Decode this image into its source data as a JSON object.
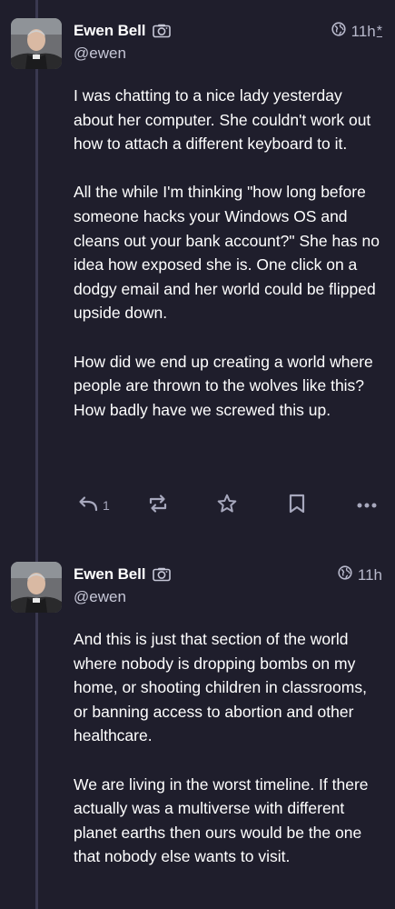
{
  "colors": {
    "background": "#1f1e2c",
    "text": "#ffffff",
    "muted": "#b8b9cc",
    "icon": "#a7a8bd",
    "thread_line": "#3a3950"
  },
  "posts": [
    {
      "author": {
        "display_name": "Ewen Bell",
        "handle": "@ewen",
        "badge_icon": "camera-icon"
      },
      "visibility_icon": "globe-icon",
      "time": "11h",
      "edited_marker": "*",
      "paragraphs": [
        "I was chatting to a nice lady yesterday about her computer. She couldn't work out how to attach a different keyboard to it.",
        "All the while I'm thinking \"how long before someone hacks your Windows OS and cleans out your bank account?\" She has no idea how exposed she is. One click on a dodgy email and her world could be flipped upside down.",
        "How did we end up creating a world where people are thrown to the wolves like this? How badly have we screwed this up."
      ],
      "actions": {
        "reply_count": "1",
        "icons": [
          "reply-icon",
          "boost-icon",
          "star-icon",
          "bookmark-icon",
          "more-icon"
        ]
      }
    },
    {
      "author": {
        "display_name": "Ewen Bell",
        "handle": "@ewen",
        "badge_icon": "camera-icon"
      },
      "visibility_icon": "globe-icon",
      "time": "11h",
      "paragraphs": [
        "And this is just that section of the world where nobody is dropping bombs on my home, or shooting children in classrooms, or banning access to abortion and other healthcare.",
        "We are living in the worst timeline. If there actually was a multiverse with different planet earths then ours would be the one that nobody else wants to visit."
      ]
    }
  ]
}
